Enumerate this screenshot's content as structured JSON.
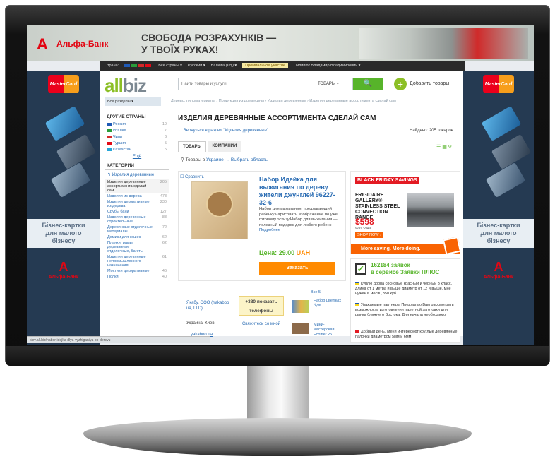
{
  "banner": {
    "bank_logo": "A",
    "bank_name": "Альфа-Банк",
    "slogan_line1": "СВОБОДА РОЗРАХУНКІВ —",
    "slogan_line2": "У ТВОЇХ РУКАХ!"
  },
  "topbar": {
    "country_label": "Страна:",
    "all_countries": "Все страны ▾",
    "language": "Русский ▾",
    "currency": "Валюта (€/$) ▾",
    "pro_label": "Премиальное участие",
    "user": "Пилипюк Владимир Владимирович ▾"
  },
  "side_ads": {
    "left_card": "MasterCard",
    "right_card": "MasterCard",
    "promo_line1": "Бізнес-картки",
    "promo_line2": "для малого",
    "promo_line3": "бізнесу",
    "bank_logo": "A",
    "bank_name": "Альфа-Банк"
  },
  "header": {
    "logo_all": "all",
    "logo_biz": "biz",
    "search_placeholder": "Найти товары и услуги",
    "search_scope": "ТОВАРЫ ▾",
    "search_button": "🔍",
    "add_plus": "+",
    "add_label": "Добавить товары",
    "sections": "Все разделы ▾",
    "breadcrumb": "Дерево, пиломатериалы › Продукция из древесины › Изделия деревянные › Изделия деревянные ассортимента сделай сам"
  },
  "left": {
    "other_countries_title": "ДРУГИЕ СТРАНЫ",
    "countries": [
      {
        "name": "Россия",
        "count": "10",
        "color": "#1f5ab5"
      },
      {
        "name": "Италия",
        "count": "7",
        "color": "#2a9d3a"
      },
      {
        "name": "Чили",
        "count": "6",
        "color": "#d32a2a"
      },
      {
        "name": "Турция",
        "count": "5",
        "color": "#e30a17"
      },
      {
        "name": "Казахстан",
        "count": "5",
        "color": "#27a6d8"
      }
    ],
    "still": "Ещё",
    "categories_title": "КАТЕГОРИИ",
    "parent_category": "↰ Изделия деревянные",
    "categories": [
      {
        "name": "Изделия деревянные ассортимента сделай сам",
        "count": "205"
      },
      {
        "name": "Изделия из дерева",
        "count": "478"
      },
      {
        "name": "Изделия декоративные из дерева",
        "count": "230"
      },
      {
        "name": "Срубы бани",
        "count": "127"
      },
      {
        "name": "Изделия деревянные строительные",
        "count": "88"
      },
      {
        "name": "Деревянные отделочные материалы",
        "count": "72"
      },
      {
        "name": "Домики для кошек",
        "count": "62"
      },
      {
        "name": "Планки, рамы деревянные отделочные, багеты",
        "count": "62"
      },
      {
        "name": "Изделия деревянные непромышленного назначения",
        "count": "61"
      },
      {
        "name": "Мостики декоративные",
        "count": "46"
      },
      {
        "name": "Полки",
        "count": "40"
      }
    ]
  },
  "content": {
    "title": "ИЗДЕЛИЯ ДЕРЕВЯННЫЕ АССОРТИМЕНТА СДЕЛАЙ САМ",
    "back_link": "← Вернуться в раздел \"Изделия деревянные\"",
    "found": "Найдено: 205 товаров",
    "tab_goods": "ТОВАРЫ",
    "tab_companies": "КОМПАНИИ",
    "view_icons": "☰ ▦ ⚲",
    "region_prefix": "⚲ Товары в ",
    "region_country": "Украине",
    "region_select": " → Выбрать область"
  },
  "product": {
    "compare": "☐ Сравнить",
    "title": "Набор Идейка для выжигания по дереву жители джунглей 96227-32-6",
    "description": "Набор для выжигания, предлагающий ребенку нарисовать изображение по уже готовому эскизу.Набор для выжигания — полезный подарок для любого ребенк",
    "more": "Подробнее",
    "price_label": "Цена: 29.00",
    "currency": "UAH",
    "order_button": "Заказать"
  },
  "seller": {
    "name": "Якабу, ООО (Yakaboo ua, LTD)",
    "location": "Украина, Киев",
    "site": "yakaboo.ua",
    "phone_line1": "+380 показать",
    "phone_line2": "телефоны",
    "contact": "Свяжитесь со мной",
    "all_link": "Все 5",
    "mini1_text": "Набор цветных букв",
    "mini2_text": "Мини-мастерская Ecoffier 25"
  },
  "ad": {
    "black_friday": "BLACK FRIDAY SAVINGS",
    "product_name": "FRIGIDAIRE GALLERY® STAINLESS STEEL CONVECTION RANGE",
    "price": "$598",
    "was": "Was $949",
    "shop": "SHOP NOW ›",
    "bar": "More saving. More doing."
  },
  "requests": {
    "check": "✓",
    "count": "162184 заявок",
    "service": "в сервисе Заявки ПЛЮС",
    "items": [
      "Куплю дрова сосновые красный и черный 3 класс, длина от 1 метра и выше диаметр от 12 и выше, мне нужен в месяц 350 куб",
      "Уважаемые партнеры Предлагаю Вам рассмотреть возможность изготовления палетной заготовки для рынка ближнего Востока. Для начала необходимо",
      "Добрый день. Меня интересуют круглые деревянные палочки диаметром 5мм и 6мм"
    ]
  },
  "status_url": "kiev.all.biz/nabor-idejka-dlya-vyzhiganiya-po-derevu"
}
